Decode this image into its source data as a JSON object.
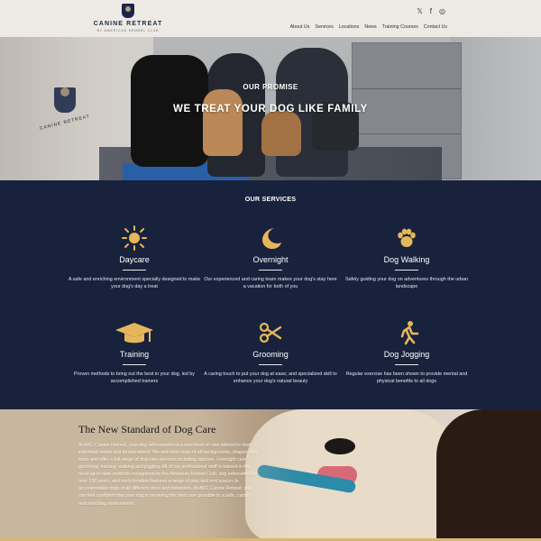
{
  "brand": {
    "name": "CANINE RETREAT",
    "sub": "BY AMERICAN KENNEL CLUB",
    "colors": {
      "navy": "#18223d",
      "gold": "#e6b75a",
      "topbar": "#edeae6"
    }
  },
  "header": {
    "social": [
      {
        "name": "twitter-icon",
        "glyph": "𝕏"
      },
      {
        "name": "facebook-icon",
        "glyph": "f"
      },
      {
        "name": "instagram-icon",
        "glyph": "◎"
      }
    ],
    "nav": [
      "About Us",
      "Services",
      "Locations",
      "News",
      "Training Courses",
      "Contact Us"
    ]
  },
  "hero": {
    "kicker": "OUR PROMISE",
    "title": "WE TREAT YOUR DOG LIKE FAMILY",
    "wall_logo_text": "CANINE RETREAT"
  },
  "services": {
    "title": "OUR SERVICES",
    "items": [
      {
        "name": "Daycare",
        "icon": "sun-icon",
        "desc": "A safe and enriching environment specially designed to make your dog's day a treat"
      },
      {
        "name": "Overnight",
        "icon": "moon-icon",
        "desc": "Our experienced and caring team makes your dog's stay here a vacation for both of you"
      },
      {
        "name": "Dog Walking",
        "icon": "paw-icon",
        "desc": "Safely guiding your dog on adventures through the urban landscape"
      },
      {
        "name": "Training",
        "icon": "graduation-cap-icon",
        "desc": "Proven methods to bring out the best in your dog, led by accomplished trainers"
      },
      {
        "name": "Grooming",
        "icon": "scissors-icon",
        "desc": "A caring touch to put your dog at ease; and specialized skill to enhance your dog's natural beauty"
      },
      {
        "name": "Dog Jogging",
        "icon": "runner-icon",
        "desc": "Regular exercise has been shown to provide mental and physical benefits to all dogs"
      }
    ]
  },
  "standard": {
    "title": "The New Standard of Dog Care",
    "body": "At AKC Canine Retreat, your dog will experience a new level of care tailored to their individual needs and temperament. We welcome dogs of all backgrounds, shapes and sizes and offer a full range of dog care services including daycare, overnight care, grooming, training, walking and jogging. All of our professional staff is trained in the most up-to-date methods recognized by the American Kennel Club, dog advocates for over 130 years, and each location features a range of play and rest spaces to accommodate dogs of all different sizes and behaviors. At AKC Canine Retreat, you can feel confident that your dog is receiving the best care possible in a safe, caring and enriching environment."
  }
}
